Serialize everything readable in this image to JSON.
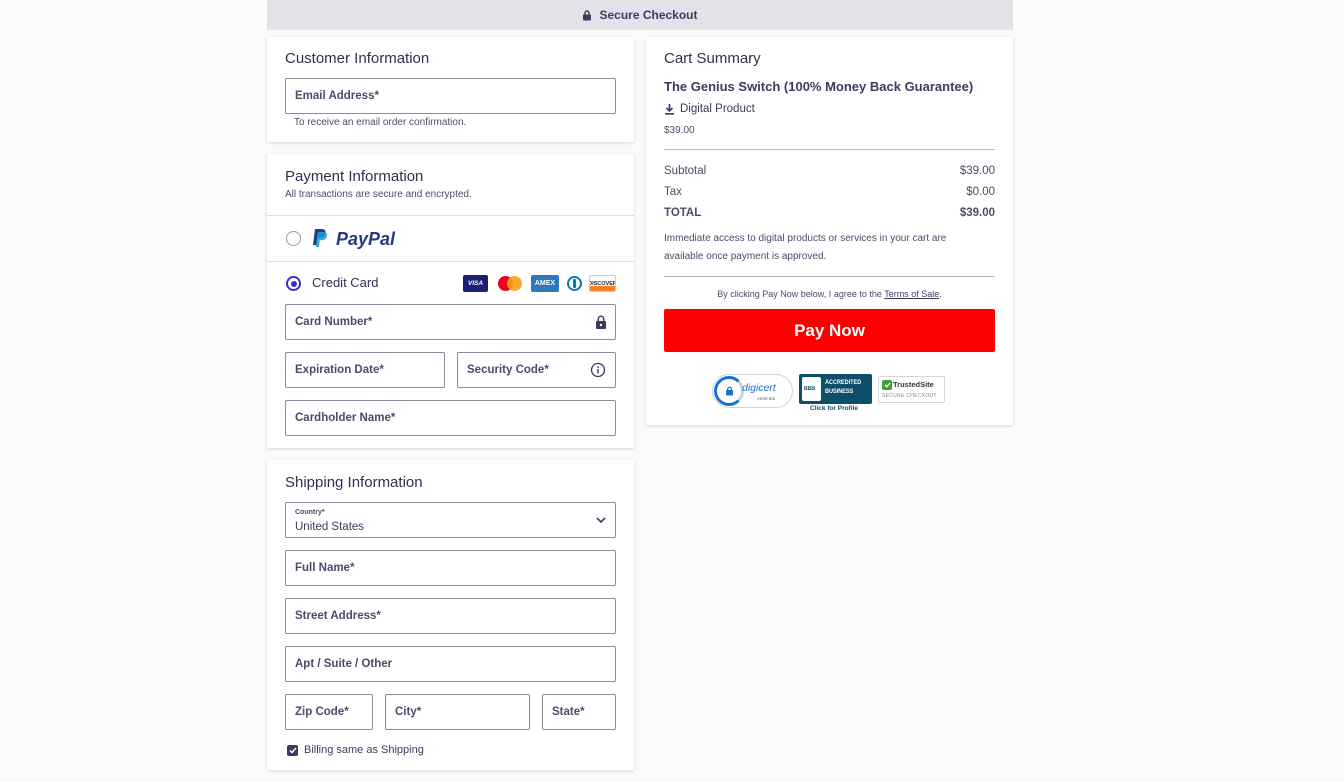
{
  "topbar": {
    "title": "Secure Checkout",
    "icon": "lock-icon"
  },
  "customer": {
    "title": "Customer Information",
    "email_label": "Email Address*",
    "email_hint": "To receive an email order confirmation."
  },
  "payment": {
    "title": "Payment Information",
    "subtitle": "All transactions are secure and encrypted.",
    "paypal_label": "PayPal",
    "paypal_selected": false,
    "credit_card_label": "Credit Card",
    "credit_card_selected": true,
    "card_logos": [
      "VISA",
      "mastercard",
      "AMEX",
      "Diners Club",
      "DISCOVER"
    ],
    "card_number_label": "Card Number*",
    "expiration_label": "Expiration Date*",
    "security_code_label": "Security Code*",
    "cardholder_label": "Cardholder Name*"
  },
  "shipping": {
    "title": "Shipping Information",
    "country_label": "Country*",
    "country_value": "United States",
    "full_name_label": "Full Name*",
    "street_label": "Street Address*",
    "apt_label": "Apt / Suite / Other",
    "zip_label": "Zip Code*",
    "city_label": "City*",
    "state_label": "State*",
    "billing_same_label": "Billing same as Shipping",
    "billing_same_checked": true
  },
  "cart": {
    "title": "Cart Summary",
    "product_name": "The Genius Switch (100% Money Back Guarantee)",
    "product_type": "Digital Product",
    "product_price": "$39.00",
    "subtotal_label": "Subtotal",
    "subtotal_value": "$39.00",
    "tax_label": "Tax",
    "tax_value": "$0.00",
    "total_label": "TOTAL",
    "total_value": "$39.00",
    "access_note": "Immediate access to digital products or services in your cart are available once payment is approved.",
    "terms_prefix": "By clicking Pay Now below, I agree to the ",
    "terms_link": "Terms of Sale",
    "terms_suffix": ".",
    "pay_button": "Pay Now"
  },
  "badges": {
    "digicert": "digicert",
    "digicert_sub": "VERIFIED",
    "bbb_line1": "ACCREDITED",
    "bbb_line2": "BUSINESS",
    "bbb_mark": "BBB",
    "bbb_caption": "Click for Profile",
    "trustedsite": "TrustedSite",
    "trustedsite_sub": "SECURE CHECKOUT"
  },
  "colors": {
    "accent": "#3b2bd0",
    "pay_button": "#fa0000",
    "text": "#3a3c5e",
    "topbar_bg": "#e2e2e8"
  }
}
